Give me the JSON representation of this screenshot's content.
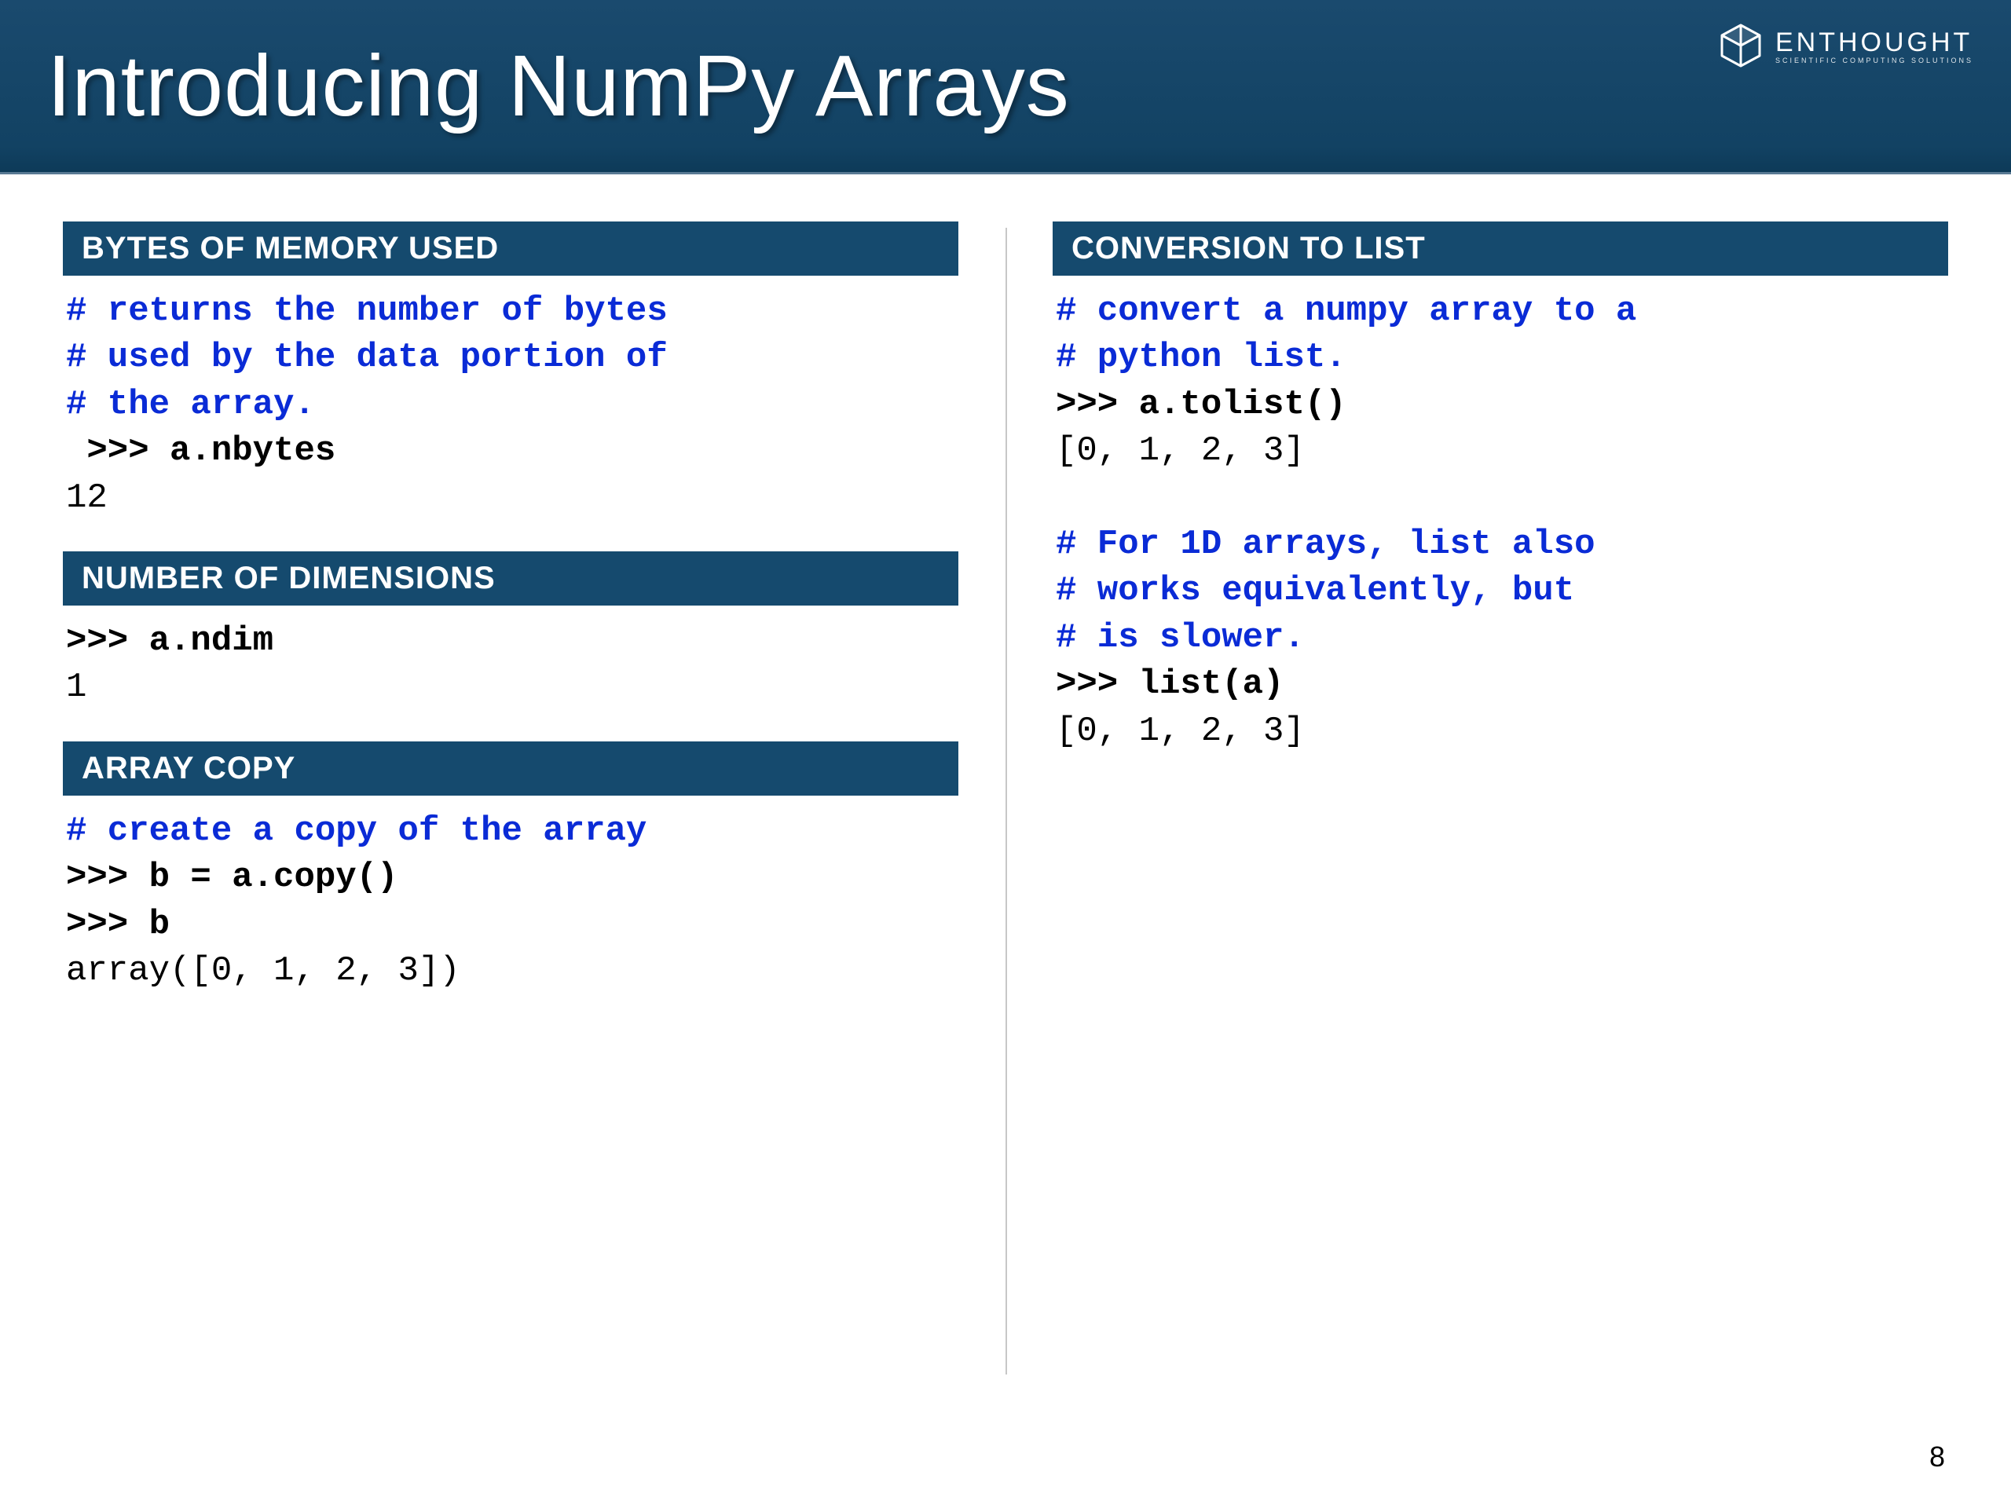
{
  "brand": {
    "name_light": "EN",
    "name_bold": "THOUGHT",
    "tagline": "SCIENTIFIC COMPUTING SOLUTIONS"
  },
  "title": "Introducing NumPy Arrays",
  "page_number": "8",
  "left": {
    "s1": {
      "header": "BYTES OF MEMORY USED",
      "c1": "# returns the number of bytes",
      "c2": "# used by the data portion of",
      "c3": "# the array.",
      "p1": " >>> a.nbytes",
      "o1": "12"
    },
    "s2": {
      "header": "NUMBER OF DIMENSIONS",
      "p1": ">>> a.ndim",
      "o1": "1"
    },
    "s3": {
      "header": "ARRAY COPY",
      "c1": "# create a copy of the array",
      "p1": ">>> b = a.copy()",
      "p2": ">>> b",
      "o1": "array([0, 1, 2, 3])"
    }
  },
  "right": {
    "s1": {
      "header": "CONVERSION TO LIST",
      "c1": "# convert a numpy array to a",
      "c2": "# python list.",
      "p1": ">>> a.tolist()",
      "o1": "[0, 1, 2, 3]",
      "blank": " ",
      "c3": "# For 1D arrays, list also",
      "c4": "# works equivalently, but",
      "c5": "# is slower.",
      "p2": ">>> list(a)",
      "o2": "[0, 1, 2, 3]"
    }
  }
}
